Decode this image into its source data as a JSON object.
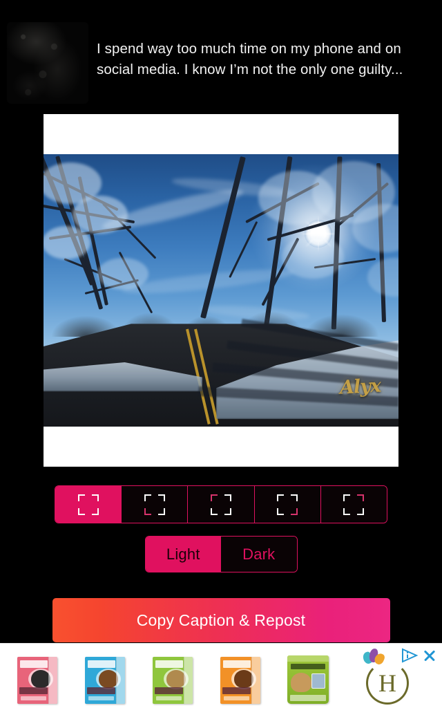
{
  "app": {
    "background_color": "#000000",
    "accent_color": "#e0115f"
  },
  "post": {
    "avatar_alt": "avatar",
    "caption": "I spend way too much time on my phone and on social media. I know I’m not the only one guilty..."
  },
  "preview": {
    "card_background": "#ffffff",
    "photo_alt": "winter road lined with frost covered trees under a bright sun and blue sky",
    "watermark": "Alyx"
  },
  "frame_options": {
    "label": "frame style",
    "selected_index": 0,
    "items": [
      {
        "id": "frame-1",
        "icon": "crop-frame-icon",
        "accent_corner": "bl",
        "selected": true
      },
      {
        "id": "frame-2",
        "icon": "crop-frame-icon",
        "accent_corner": "bl",
        "selected": false
      },
      {
        "id": "frame-3",
        "icon": "crop-frame-icon",
        "accent_corner": "tl",
        "selected": false
      },
      {
        "id": "frame-4",
        "icon": "crop-frame-icon",
        "accent_corner": "br",
        "selected": false
      },
      {
        "id": "frame-5",
        "icon": "crop-frame-icon",
        "accent_corner": "tr",
        "selected": false
      }
    ]
  },
  "tone_toggle": {
    "selected": "Light",
    "options": [
      {
        "label": "Light",
        "selected": true
      },
      {
        "label": "Dark",
        "selected": false
      }
    ]
  },
  "cta": {
    "label": "Copy Caption & Repost",
    "gradient_from": "#f9512f",
    "gradient_to": "#ec2682"
  },
  "ad": {
    "background_color": "#ffffff",
    "products": [
      {
        "name": "product-box-pink",
        "box_color": "#e8647a",
        "dog_color": "#2b2b2b"
      },
      {
        "name": "product-box-blue",
        "box_color": "#2fa8d8",
        "dog_color": "#7a4a22"
      },
      {
        "name": "product-box-green",
        "box_color": "#8fc63d",
        "dog_color": "#b08a4e"
      },
      {
        "name": "product-box-orange",
        "box_color": "#f29127",
        "dog_color": "#6b3b18"
      },
      {
        "name": "product-pouch-green",
        "box_color": "#8cba2f",
        "dog_color": "#c79a5c"
      }
    ],
    "logo_letter": "H",
    "adchoices_label": "AdChoices",
    "close_label": "×",
    "control_color": "#2196d4"
  }
}
